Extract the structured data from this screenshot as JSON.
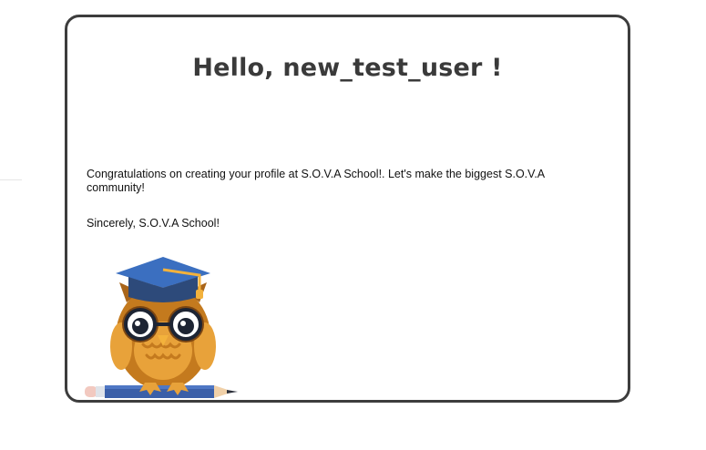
{
  "email": {
    "greeting": "Hello, new_test_user !",
    "message": "Congratulations on creating your profile at S.O.V.A School!. Let's make the biggest S.O.V.A community!",
    "signature": "Sincerely, S.O.V.A School!"
  },
  "mascot": {
    "icon": "owl-graduate-icon"
  },
  "colors": {
    "card_border": "#3d3d3d",
    "heading": "#3a3a3a",
    "owl_body": "#c47a1e",
    "cap": "#2d4a7a",
    "pencil": "#3b5fa8"
  }
}
